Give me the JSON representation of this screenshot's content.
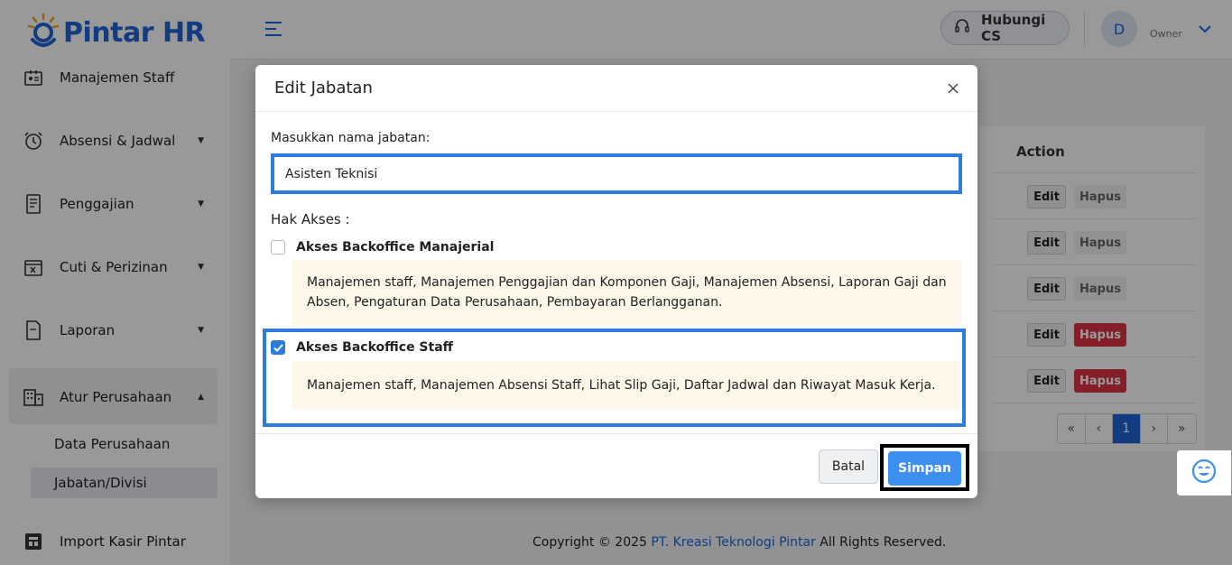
{
  "brand": {
    "name": "Pintar HR",
    "color": "#1e63d6"
  },
  "sidebar": {
    "items": [
      {
        "label": "Manajemen Staff",
        "icon": "id-card-icon"
      },
      {
        "label": "Absensi & Jadwal",
        "icon": "alarm-clock-icon"
      },
      {
        "label": "Penggajian",
        "icon": "receipt-icon"
      },
      {
        "label": "Cuti & Perizinan",
        "icon": "calendar-x-icon"
      },
      {
        "label": "Laporan",
        "icon": "document-icon"
      },
      {
        "label": "Atur Perusahaan",
        "icon": "building-icon"
      },
      {
        "label": "Import Kasir Pintar",
        "icon": "import-icon"
      }
    ],
    "subitems": [
      "Data Perusahaan",
      "Jabatan/Divisi"
    ]
  },
  "topbar": {
    "cs_label": "Hubungi CS",
    "avatar_initial": "D",
    "role": "Owner"
  },
  "table": {
    "action_header": "Action",
    "edit_label": "Edit",
    "delete_label": "Hapus",
    "rows": [
      {
        "delete_enabled": false
      },
      {
        "delete_enabled": false
      },
      {
        "delete_enabled": false
      },
      {
        "delete_enabled": true
      },
      {
        "delete_enabled": true
      }
    ]
  },
  "pagination": {
    "first": "«",
    "prev": "‹",
    "current": "1",
    "next": "›",
    "last": "»"
  },
  "modal": {
    "title": "Edit Jabatan",
    "name_label": "Masukkan nama jabatan:",
    "name_value": "Asisten Teknisi",
    "access_label": "Hak Akses :",
    "options": [
      {
        "label": "Akses Backoffice Manajerial",
        "checked": false,
        "description": "Manajemen staff, Manajemen Penggajian dan Komponen Gaji, Manajemen Absensi, Laporan Gaji dan Absen, Pengaturan Data Perusahaan, Pembayaran Berlangganan."
      },
      {
        "label": "Akses Backoffice Staff",
        "checked": true,
        "description": "Manajemen staff, Manajemen Absensi Staff, Lihat Slip Gaji, Daftar Jadwal dan Riwayat Masuk Kerja."
      }
    ],
    "cancel_label": "Batal",
    "save_label": "Simpan"
  },
  "footer": {
    "prefix": "Copyright © 2025 ",
    "company": "PT. Kreasi Teknologi Pintar",
    "suffix": " All Rights Reserved."
  },
  "colors": {
    "primary": "#1e63d6",
    "save_button": "#3d8ff0",
    "danger": "#dc3545",
    "description_bg": "#fdf7ea"
  }
}
